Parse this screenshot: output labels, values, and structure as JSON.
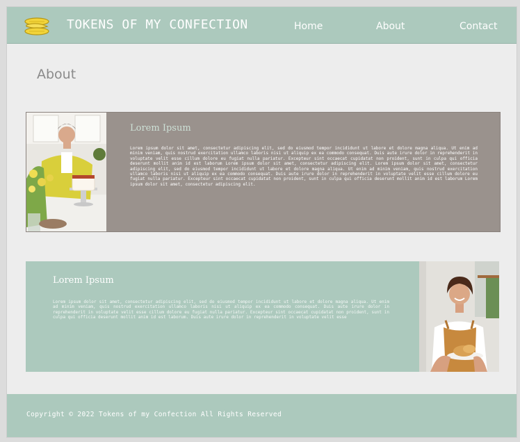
{
  "header": {
    "brand": "TOKENS OF MY CONFECTION",
    "nav": [
      "Home",
      "About",
      "Contact"
    ]
  },
  "page": {
    "title": "About"
  },
  "cards": [
    {
      "title": "Lorem Ipsum",
      "body": "Lorem ipsum dolor sit amet, consectetur adipiscing elit, sed do eiusmod tempor incididunt ut labore et dolore magna aliqua. Ut enim ad minim veniam, quis nostrud exercitation ullamco laboris nisi ut aliquip ex ea commodo consequat. Duis aute irure dolor in reprehenderit in voluptate velit esse cillum dolore eu fugiat nulla pariatur. Excepteur sint occaecat cupidatat non proident, sunt in culpa qui officia deserunt mollit anim id est laborum Lorem ipsum dolor sit amet, consectetur adipiscing elit. Lorem ipsum dolor sit amet, consectetur adipiscing elit, sed do eiusmod tempor incididunt ut labore et dolore magna aliqua. Ut enim ad minim veniam, quis nostrud exercitation ullamco laboris nisi ut aliquip ex ea commodo consequat. Duis aute irure dolor in reprehenderit in voluptate velit esse cillum dolore eu fugiat nulla pariatur. Excepteur sint occaecat cupidatat non proident, sunt in culpa qui officia deserunt mollit anim id est laborum Lorem ipsum dolor sit amet, consectetur adipiscing elit."
    },
    {
      "title": "Lorem Ipsum",
      "body": "Lorem ipsum dolor sit amet, consectetur adipiscing elit, sed do eiusmod tempor incididunt ut labore et dolore magna aliqua. Ut enim ad minim veniam, quis nostrud exercitation ullamco laboris nisi ut aliquip ex ea commodo consequat. Duis aute irure dolor in reprehenderit in voluptate velit esse cillum dolore eu fugiat nulla pariatur. Excepteur sint occaecat cupidatat non proident, sunt in culpa qui officia deserunt mollit anim id est laborum. Duis aute irure dolor in reprehenderit in voluptate velit esse"
    }
  ],
  "footer": {
    "copyright": "Copyright © 2022 Tokens of my Confection All Rights Reserved"
  },
  "colors": {
    "header_bg": "#acc9bd",
    "card1_bg": "#9a928d",
    "card2_bg": "#acc9bd",
    "logo": "#f2d43a"
  }
}
